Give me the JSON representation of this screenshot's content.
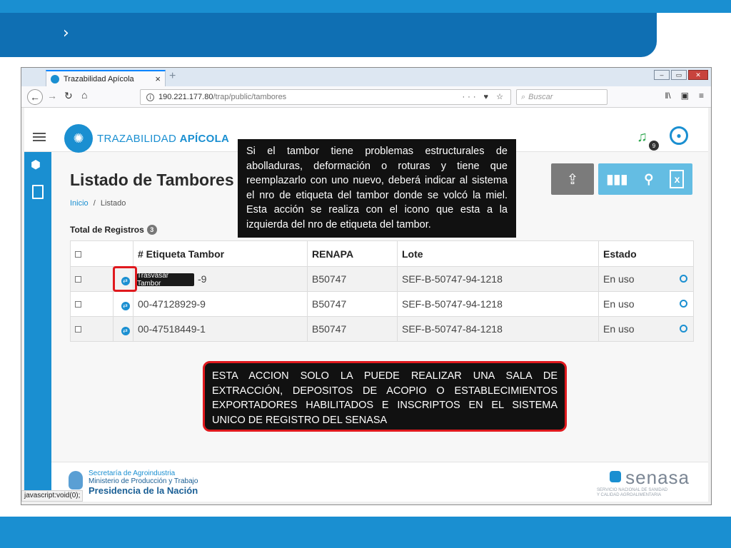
{
  "slide": {
    "chevron": "›"
  },
  "browser": {
    "tab_title": "Trazabilidad Apícola",
    "tab_close": "×",
    "tab_new": "+",
    "url_host": "190.221.177.80",
    "url_path": "/trap/public/tambores",
    "url_actions": "··· ♥ ☆",
    "search_placeholder": "Buscar",
    "status_text": "javascript:void(0);"
  },
  "app": {
    "logo_text_light": "TRAZABILIDAD ",
    "logo_text_bold": "APÍCOLA",
    "notification_count": "9"
  },
  "page": {
    "title": "Listado de Tambores",
    "breadcrumb_home": "Inicio",
    "breadcrumb_sep": "/",
    "breadcrumb_current": "Listado",
    "total_label": "Total de Registros",
    "total_count": "3"
  },
  "table": {
    "headers": {
      "etiqueta": "# Etiqueta Tambor",
      "renapa": "RENAPA",
      "lote": "Lote",
      "estado": "Estado"
    },
    "rows": [
      {
        "etiqueta": "-9",
        "renapa": "B50747",
        "lote": "SEF-B-50747-94-1218",
        "estado": "En uso"
      },
      {
        "etiqueta": "00-47128929-9",
        "renapa": "B50747",
        "lote": "SEF-B-50747-94-1218",
        "estado": "En uso"
      },
      {
        "etiqueta": "00-47518449-1",
        "renapa": "B50747",
        "lote": "SEF-B-50747-84-1218",
        "estado": "En uso"
      }
    ],
    "tooltip": "Trasvasar Tambor"
  },
  "footer": {
    "line1": "Secretaría de Agroindustria",
    "line2": "Ministerio de Producción y Trabajo",
    "line3": "Presidencia de la Nación",
    "senasa": "senasa",
    "senasa_sub": "SERVICIO NACIONAL DE SANIDAD Y CALIDAD AGROALIMENTARIA"
  },
  "callouts": {
    "top": "Si el tambor tiene problemas estructurales de abolladuras, deformación o roturas y tiene que reemplazarlo con uno nuevo, deberá indicar al sistema el nro de etiqueta del tambor donde se volcó la miel. Esta acción se realiza con el icono que esta a la izquierda del nro de etiqueta del tambor.",
    "bottom": "ESTA ACCION SOLO LA PUEDE REALIZAR UNA SALA DE EXTRACCIÓN, DEPOSITOS DE ACOPIO O ESTABLECIMIENTOS EXPORTADORES HABILITADOS E INSCRIPTOS EN EL SISTEMA UNICO DE REGISTRO DEL SENASA"
  },
  "colors": {
    "brand_blue": "#1a8fd1",
    "header_dark_blue": "#0f6fb3",
    "highlight_red": "#e0191e",
    "bell_green": "#2fa84f"
  },
  "icons": [
    "chevron-right-icon",
    "back-icon",
    "forward-icon",
    "reload-icon",
    "home-icon",
    "info-icon",
    "search-icon",
    "library-icon",
    "sidebar-toggle-icon",
    "menu-icon",
    "bee-icon",
    "bell-icon",
    "user-icon",
    "hexagons-icon",
    "document-icon",
    "upload-icon",
    "bar-chart-icon",
    "magnifier-icon",
    "excel-icon",
    "transfer-icon",
    "history-icon"
  ]
}
